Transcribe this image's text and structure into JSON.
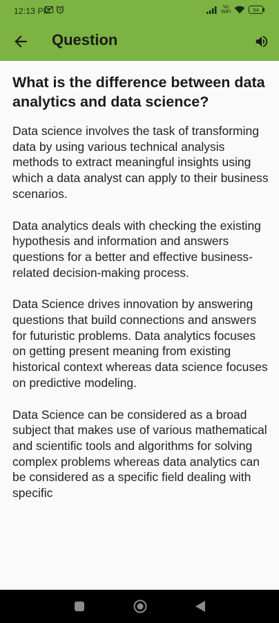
{
  "status_bar": {
    "time": "12:13 PM",
    "left_icons": [
      "gmail-icon",
      "alarm-icon"
    ],
    "right_icons": [
      "signal-icon",
      "volte-icon",
      "wifi-icon",
      "battery-icon"
    ],
    "volte_label_top": "Vo",
    "volte_label_bottom": "WiFi",
    "battery_level": "54"
  },
  "app_bar": {
    "title": "Question",
    "back_icon": "arrow-back-icon",
    "action_icon": "volume-icon",
    "color": "#7cb342"
  },
  "content": {
    "question": "What is the difference between data analytics and data science?",
    "paragraphs": [
      "Data science involves the task of transforming data by using various technical analysis methods to extract meaningful insights using which a data analyst can apply to their business scenarios.",
      "Data analytics deals with checking the existing hypothesis and information and answers questions for a better and effective business-related decision-making process.",
      "Data Science drives innovation by answering questions that build connections and answers for futuristic problems. Data analytics focuses on getting present meaning from existing historical context whereas data science focuses on predictive modeling.",
      "Data Science can be considered as a broad subject that makes use of various mathematical and scientific tools and algorithms for solving complex problems whereas data analytics can be considered as a specific field dealing with specific"
    ]
  },
  "nav_bar": {
    "icons": [
      "recents-icon",
      "home-icon",
      "back-icon"
    ]
  }
}
